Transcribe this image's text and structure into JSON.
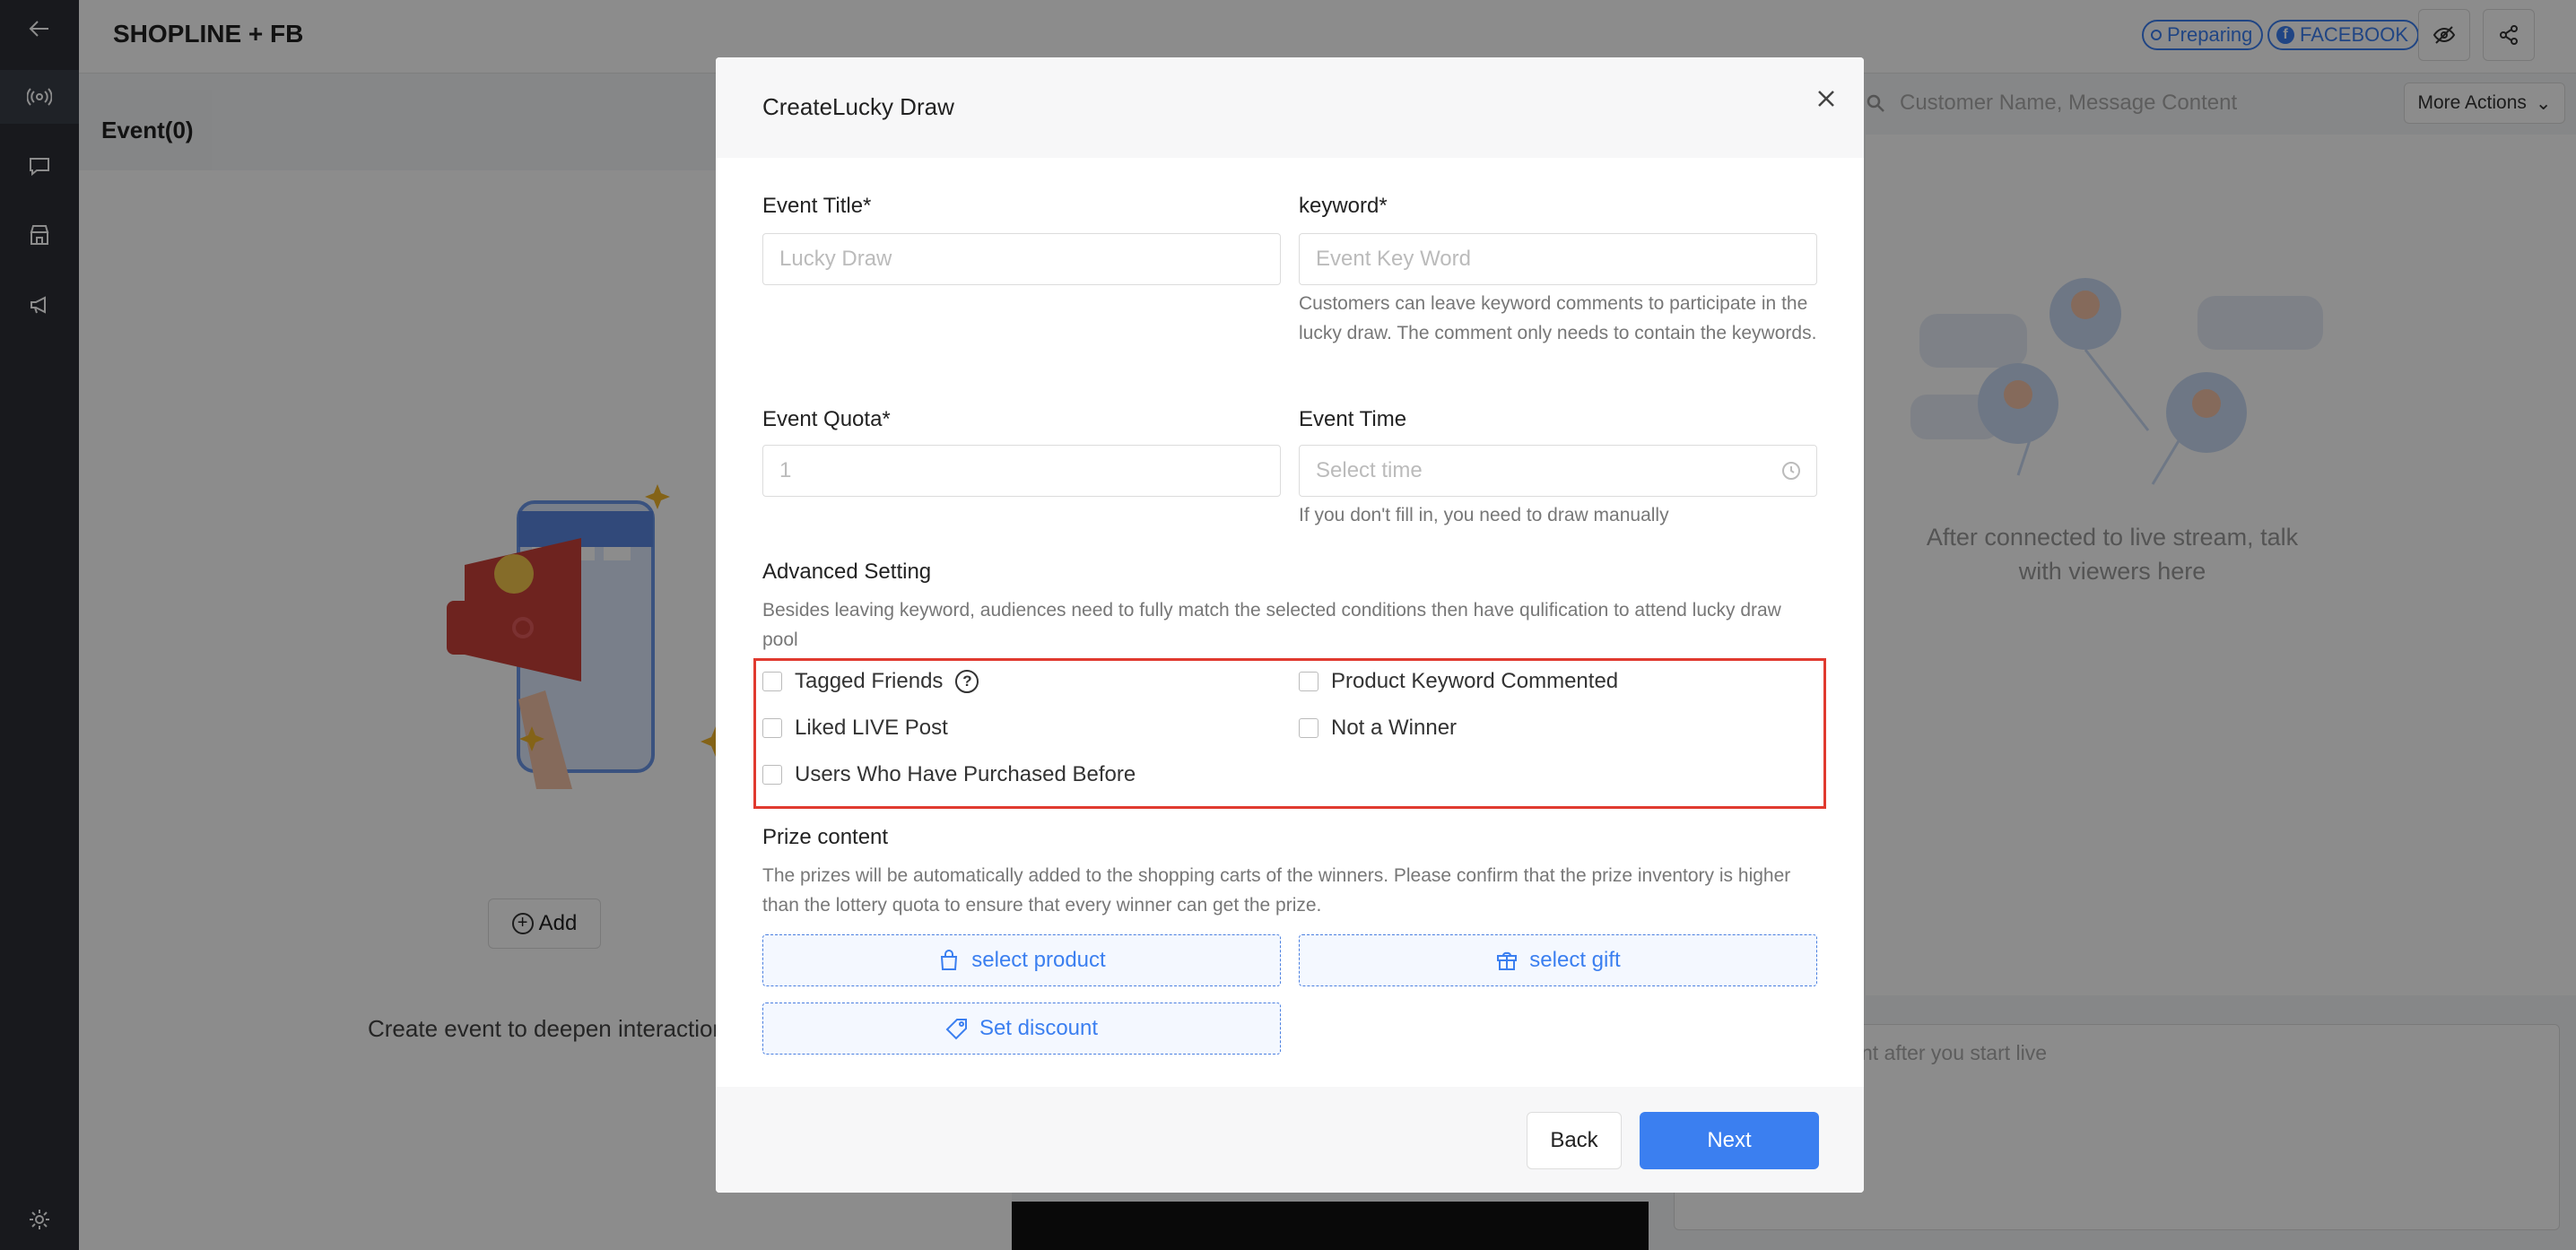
{
  "app": {
    "title": "SHOPLINE + FB",
    "status_label": "Preparing",
    "platform_label": "FACEBOOK",
    "colors": {
      "accent": "#3b7ff0",
      "highlight": "#e03a2f",
      "rail": "#2c2f36"
    }
  },
  "rail_icons": [
    "back-arrow-icon",
    "broadcast-icon",
    "chat-icon",
    "store-icon",
    "megaphone-icon",
    "settings-icon"
  ],
  "events": {
    "tab_label": "Event(0)",
    "empty_text": "Create event to deepen interaction with",
    "add_label": "Add"
  },
  "chat": {
    "search_placeholder": "Customer Name, Message Content",
    "more_actions_label": "More Actions",
    "empty_text": "After connected to live stream, talk with viewers here",
    "composer_placeholder": "ment after you start live"
  },
  "modal": {
    "title": "CreateLucky Draw",
    "event_title": {
      "label": "Event Title*",
      "placeholder": "Lucky Draw"
    },
    "keyword": {
      "label": "keyword*",
      "placeholder": "Event Key Word",
      "help": "Customers can leave keyword comments to participate in the lucky draw. The comment only needs to contain the keywords."
    },
    "quota": {
      "label": "Event Quota*",
      "placeholder": "1"
    },
    "time": {
      "label": "Event Time",
      "placeholder": "Select time",
      "help": "If you don't fill in, you need to draw manually"
    },
    "advanced": {
      "title": "Advanced Setting",
      "description": "Besides leaving keyword, audiences need to fully match the selected conditions then have qulification to attend lucky draw pool",
      "options": {
        "tagged_friends": "Tagged Friends",
        "product_keyword": "Product Keyword Commented",
        "liked_live": "Liked LIVE Post",
        "not_winner": "Not a Winner",
        "purchased_before": "Users Who Have Purchased Before"
      }
    },
    "prize": {
      "title": "Prize content",
      "description": "The prizes will be automatically added to the shopping carts of the winners. Please confirm that the prize inventory is higher than the lottery quota to ensure that every winner can get the prize.",
      "select_product": "select product",
      "select_gift": "select gift",
      "set_discount": "Set discount"
    },
    "back_label": "Back",
    "next_label": "Next"
  }
}
